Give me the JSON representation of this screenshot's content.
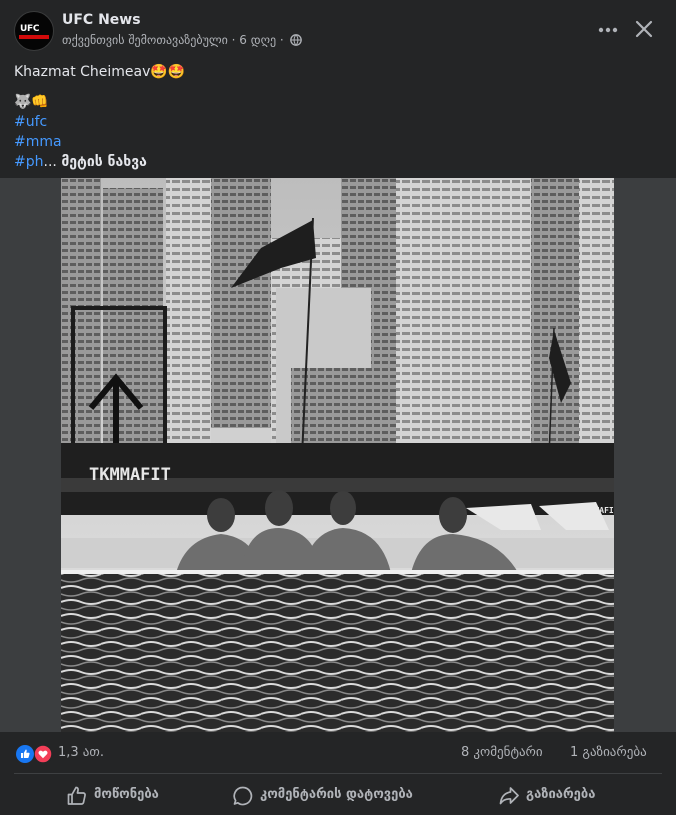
{
  "header": {
    "page_name": "UFC News",
    "meta": "თქვენთვის შემოთავაზებული · 6 დღე ·",
    "avatar_logo_text": "UFC",
    "icons": {
      "privacy": "globe-icon",
      "more": "more-horizontal-icon",
      "close": "close-icon"
    }
  },
  "post": {
    "caption": "Khazmat Cheimeav🤩🤩",
    "emoji_line": "🐺👊",
    "hashtags": [
      "#ufc",
      "#mma",
      "#ph"
    ],
    "ellipsis": "... ",
    "see_more": "მეტის ნახვა"
  },
  "photo": {
    "description_visible": false,
    "sign_text": "TKMMAFIT",
    "sign_text_small": "TKMMAFIT",
    "colors": {
      "sky": "#d8d8d8",
      "buildings": "#a6a6a6",
      "water": "#2a2a2a"
    }
  },
  "reactions": {
    "count": "1,3 ათ.",
    "comments": "8 კომენტარი",
    "shares": "1 გაზიარება",
    "icons": [
      "like-reaction-icon",
      "love-reaction-icon"
    ],
    "colors": {
      "like": "#1877f2",
      "love": "#f33e58"
    }
  },
  "actions": {
    "like": "მოწონება",
    "comment": "კომენტარის დატოვება",
    "share": "გაზიარება"
  },
  "colors": {
    "background": "#242526",
    "text": "#e4e6eb",
    "secondary": "#b0b3b8",
    "link": "#4599ff"
  }
}
